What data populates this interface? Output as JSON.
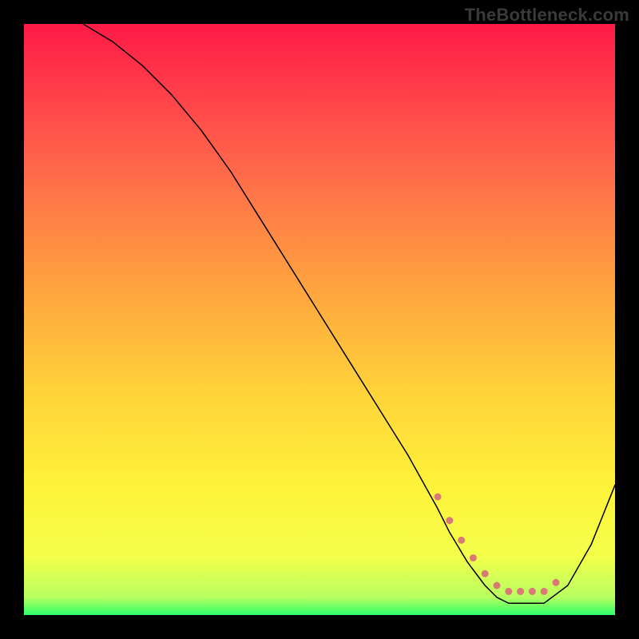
{
  "watermark": "TheBottleneck.com",
  "chart_data": {
    "type": "line",
    "title": "",
    "xlabel": "",
    "ylabel": "",
    "xlim": [
      0,
      100
    ],
    "ylim": [
      0,
      100
    ],
    "grid": false,
    "legend": false,
    "series": [
      {
        "name": "curve",
        "x": [
          10,
          15,
          20,
          25,
          30,
          35,
          40,
          45,
          50,
          55,
          60,
          65,
          70,
          72,
          75,
          78,
          80,
          82,
          85,
          88,
          92,
          96,
          100
        ],
        "y": [
          100,
          97,
          93,
          88,
          82,
          75,
          67,
          59,
          51,
          43,
          35,
          27,
          18,
          14,
          9,
          5,
          3,
          2,
          2,
          2,
          5,
          12,
          22
        ],
        "color": "#000000",
        "linewidth": 1.5
      }
    ],
    "flat_band": {
      "x_start": 70,
      "x_end": 90,
      "color": "#d97a77",
      "point_radius": 4.5,
      "points_x": [
        70,
        72,
        74,
        76,
        78,
        80,
        82,
        84,
        86,
        88,
        90
      ],
      "points_y_offset": 2
    },
    "background_gradient": {
      "stops": [
        {
          "offset": 0.0,
          "color": "#ff1a46"
        },
        {
          "offset": 0.1,
          "color": "#ff3a4a"
        },
        {
          "offset": 0.25,
          "color": "#ff6a4a"
        },
        {
          "offset": 0.45,
          "color": "#ffa53f"
        },
        {
          "offset": 0.62,
          "color": "#ffd23a"
        },
        {
          "offset": 0.78,
          "color": "#fff23a"
        },
        {
          "offset": 0.9,
          "color": "#f4ff4a"
        },
        {
          "offset": 0.97,
          "color": "#b8ff60"
        },
        {
          "offset": 1.0,
          "color": "#2bff6a"
        }
      ]
    }
  }
}
